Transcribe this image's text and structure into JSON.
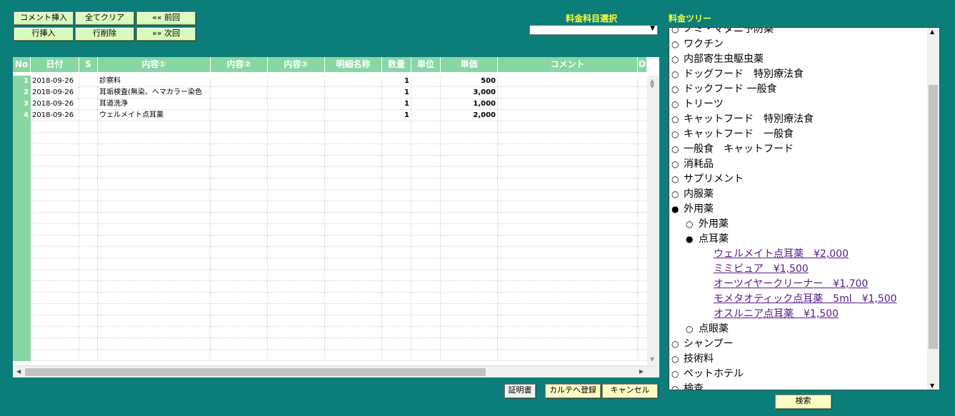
{
  "toolbar": {
    "comment_insert": "コメント挿入",
    "clear_all": "全てクリア",
    "prev": "«« 前回",
    "row_insert": "行挿入",
    "row_delete": "行削除",
    "next": "»» 次回"
  },
  "fee_select": {
    "label": "料金科目選択",
    "value": ""
  },
  "fee_tree": {
    "label": "料金ツリー"
  },
  "grid": {
    "columns": [
      "No",
      "日付",
      "S",
      "内容①",
      "内容②",
      "内容③",
      "明細名称",
      "数量",
      "単位",
      "単価",
      "コメント",
      "D"
    ],
    "rows": [
      {
        "no": "1",
        "date": "2018-09-26",
        "s": "",
        "content1": "診察料",
        "content2": "",
        "content3": "",
        "detail": "",
        "qty": "1",
        "unit": "",
        "price": "500",
        "comment": ""
      },
      {
        "no": "2",
        "date": "2018-09-26",
        "s": "",
        "content1": "耳垢検査(無染、ヘマカラー染色",
        "content2": "",
        "content3": "",
        "detail": "",
        "qty": "1",
        "unit": "",
        "price": "3,000",
        "comment": ""
      },
      {
        "no": "3",
        "date": "2018-09-26",
        "s": "",
        "content1": "耳道洗浄",
        "content2": "",
        "content3": "",
        "detail": "",
        "qty": "1",
        "unit": "",
        "price": "1,000",
        "comment": ""
      },
      {
        "no": "4",
        "date": "2018-09-26",
        "s": "",
        "content1": "ウェルメイト点耳薬",
        "content2": "",
        "content3": "",
        "detail": "",
        "qty": "1",
        "unit": "",
        "price": "2,000",
        "comment": ""
      }
    ]
  },
  "tree": [
    {
      "level": 0,
      "bullet": "○",
      "label": "ノミ・マダニ予防薬"
    },
    {
      "level": 0,
      "bullet": "○",
      "label": "ワクチン"
    },
    {
      "level": 0,
      "bullet": "○",
      "label": "内部寄生虫駆虫薬"
    },
    {
      "level": 0,
      "bullet": "○",
      "label": "ドッグフード　特別療法食"
    },
    {
      "level": 0,
      "bullet": "○",
      "label": "ドックフード 一般食"
    },
    {
      "level": 0,
      "bullet": "○",
      "label": "トリーツ"
    },
    {
      "level": 0,
      "bullet": "○",
      "label": "キャットフード　特別療法食"
    },
    {
      "level": 0,
      "bullet": "○",
      "label": "キャットフード　一般食"
    },
    {
      "level": 0,
      "bullet": "○",
      "label": "一般食　キャットフード"
    },
    {
      "level": 0,
      "bullet": "○",
      "label": "消耗品"
    },
    {
      "level": 0,
      "bullet": "○",
      "label": "サプリメント"
    },
    {
      "level": 0,
      "bullet": "○",
      "label": "内服薬"
    },
    {
      "level": 0,
      "bullet": "●",
      "label": "外用薬"
    },
    {
      "level": 1,
      "bullet": "○",
      "label": "外用薬"
    },
    {
      "level": 1,
      "bullet": "●",
      "label": "点耳薬"
    },
    {
      "level": 2,
      "bullet": "",
      "label": "ウェルメイト点耳薬　¥2,000"
    },
    {
      "level": 2,
      "bullet": "",
      "label": "ミミピュア　¥1,500"
    },
    {
      "level": 2,
      "bullet": "",
      "label": "オーツイヤークリーナー　¥1,700"
    },
    {
      "level": 2,
      "bullet": "",
      "label": "モメタオティック点耳薬　5ml　¥1,500"
    },
    {
      "level": 2,
      "bullet": "",
      "label": "オスルニア点耳薬　¥1,500"
    },
    {
      "level": 1,
      "bullet": "○",
      "label": "点眼薬"
    },
    {
      "level": 0,
      "bullet": "○",
      "label": "シャンプー"
    },
    {
      "level": 0,
      "bullet": "○",
      "label": "技術料"
    },
    {
      "level": 0,
      "bullet": "○",
      "label": "ペットホテル"
    },
    {
      "level": 0,
      "bullet": "○",
      "label": "検査"
    }
  ],
  "bottom": {
    "certificate": "証明書",
    "register": "カルテへ登録",
    "cancel": "キャンセル",
    "search": "検索"
  }
}
